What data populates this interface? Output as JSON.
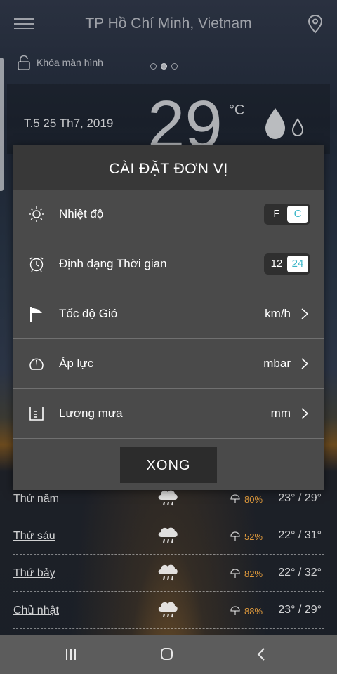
{
  "topbar": {
    "city": "TP Hồ Chí Minh, Vietnam"
  },
  "lockscreen": {
    "label": "Khóa màn hình"
  },
  "current": {
    "date": "T.5 25 Th7, 2019",
    "temp": "29",
    "unit": "°C"
  },
  "modal": {
    "title": "CÀI ĐẶT ĐƠN VỊ",
    "rows": [
      {
        "icon": "sun-icon",
        "label": "Nhiệt độ",
        "options": [
          "F",
          "C"
        ],
        "selected": "C"
      },
      {
        "icon": "alarm-clock-icon",
        "label": "Định dạng Thời gian",
        "options": [
          "12",
          "24"
        ],
        "selected": "24"
      },
      {
        "icon": "wind-flag-icon",
        "label": "Tốc độ Gió",
        "value": "km/h"
      },
      {
        "icon": "pressure-gauge-icon",
        "label": "Áp lực",
        "value": "mbar"
      },
      {
        "icon": "rain-gauge-icon",
        "label": "Lượng mưa",
        "value": "mm"
      }
    ],
    "done_label": "XONG"
  },
  "forecast": [
    {
      "day": "Thứ năm",
      "pct": "80%",
      "range": "23° / 29°"
    },
    {
      "day": "Thứ sáu",
      "pct": "52%",
      "range": "22° / 31°"
    },
    {
      "day": "Thứ bảy",
      "pct": "82%",
      "range": "22° / 32°"
    },
    {
      "day": "Chủ nhật",
      "pct": "88%",
      "range": "23° / 29°"
    }
  ],
  "colors": {
    "accent": "#3bb6c8",
    "precip": "#e09a3c",
    "modal_bg": "#4a4a4a",
    "modal_header": "#383838"
  }
}
